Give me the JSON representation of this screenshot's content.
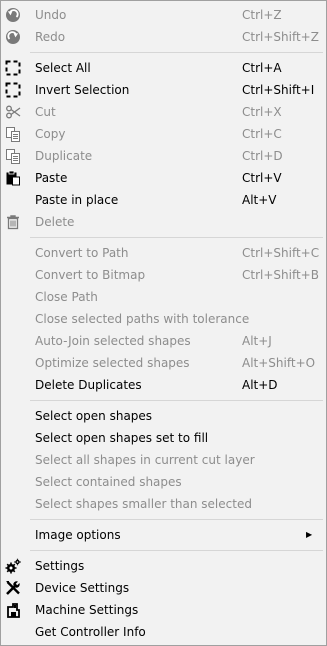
{
  "menu": {
    "undo": {
      "label": "Undo",
      "shortcut": "Ctrl+Z"
    },
    "redo": {
      "label": "Redo",
      "shortcut": "Ctrl+Shift+Z"
    },
    "select_all": {
      "label": "Select All",
      "shortcut": "Ctrl+A"
    },
    "invert_selection": {
      "label": "Invert Selection",
      "shortcut": "Ctrl+Shift+I"
    },
    "cut": {
      "label": "Cut",
      "shortcut": "Ctrl+X"
    },
    "copy": {
      "label": "Copy",
      "shortcut": "Ctrl+C"
    },
    "duplicate": {
      "label": "Duplicate",
      "shortcut": "Ctrl+D"
    },
    "paste": {
      "label": "Paste",
      "shortcut": "Ctrl+V"
    },
    "paste_in_place": {
      "label": "Paste in place",
      "shortcut": "Alt+V"
    },
    "delete": {
      "label": "Delete",
      "shortcut": ""
    },
    "convert_to_path": {
      "label": "Convert to Path",
      "shortcut": "Ctrl+Shift+C"
    },
    "convert_to_bitmap": {
      "label": "Convert to Bitmap",
      "shortcut": "Ctrl+Shift+B"
    },
    "close_path": {
      "label": "Close Path",
      "shortcut": ""
    },
    "close_selected_paths": {
      "label": "Close selected paths with tolerance",
      "shortcut": ""
    },
    "auto_join": {
      "label": "Auto-Join selected shapes",
      "shortcut": "Alt+J"
    },
    "optimize": {
      "label": "Optimize selected shapes",
      "shortcut": "Alt+Shift+O"
    },
    "delete_duplicates": {
      "label": "Delete Duplicates",
      "shortcut": "Alt+D"
    },
    "select_open_shapes": {
      "label": "Select open shapes",
      "shortcut": ""
    },
    "select_open_shapes_fill": {
      "label": "Select open shapes set to fill",
      "shortcut": ""
    },
    "select_all_in_cut_layer": {
      "label": "Select all shapes in current cut layer",
      "shortcut": ""
    },
    "select_contained": {
      "label": "Select contained shapes",
      "shortcut": ""
    },
    "select_smaller": {
      "label": "Select shapes smaller than selected",
      "shortcut": ""
    },
    "image_options": {
      "label": "Image options",
      "arrow": "▶"
    },
    "settings": {
      "label": "Settings"
    },
    "device_settings": {
      "label": "Device Settings"
    },
    "machine_settings": {
      "label": "Machine Settings"
    },
    "get_controller_info": {
      "label": "Get Controller Info"
    }
  }
}
